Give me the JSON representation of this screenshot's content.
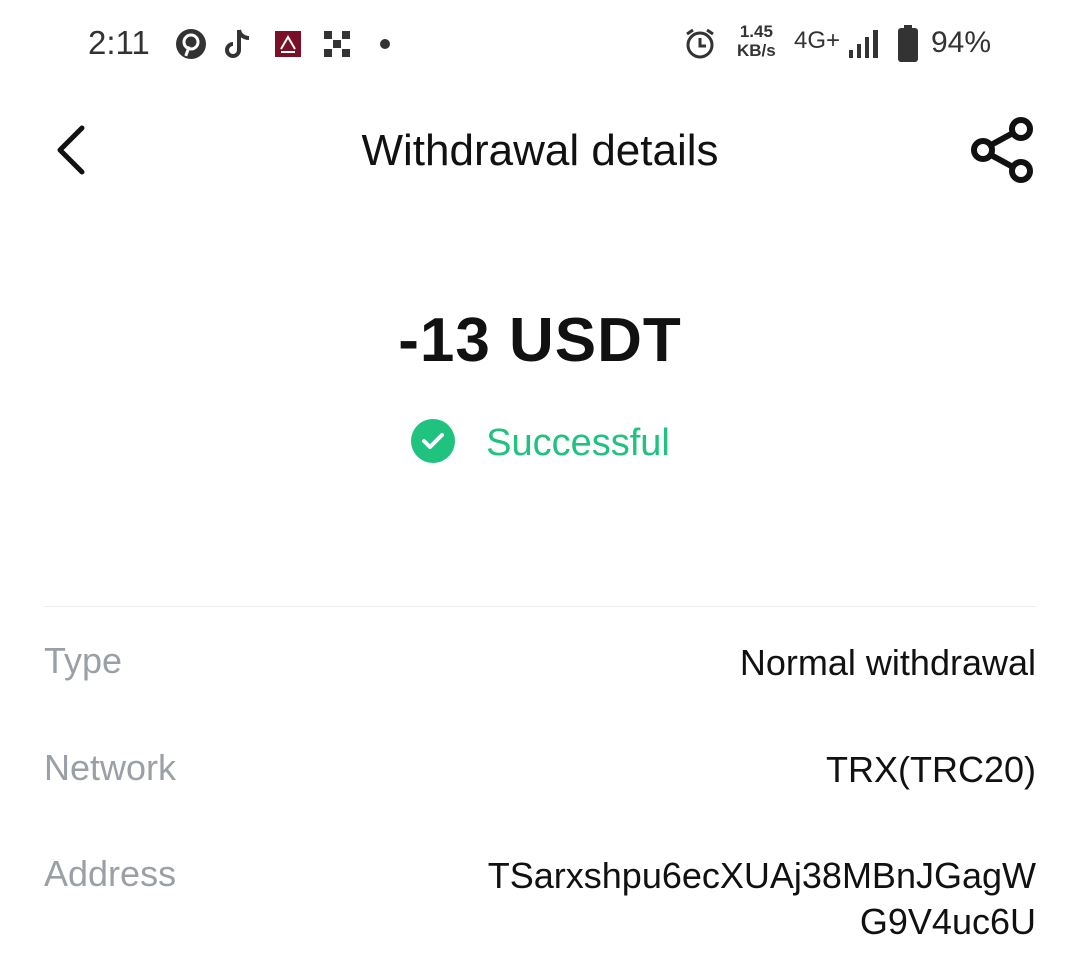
{
  "status_bar": {
    "time": "2:11",
    "speed_value": "1.45",
    "speed_unit": "KB/s",
    "network": "4G+",
    "battery_percent": "94%",
    "icons": [
      "pinterest-like-icon",
      "tiktok-icon",
      "app-badge-icon",
      "grid-app-icon",
      "notification-dot-icon",
      "alarm-icon",
      "signal-icon",
      "battery-icon"
    ]
  },
  "header": {
    "title": "Withdrawal details",
    "back_icon": "chevron-left-icon",
    "share_icon": "share-icon"
  },
  "summary": {
    "amount": "-13 USDT",
    "status": "Successful",
    "status_icon": "check-circle-icon",
    "status_color": "#20c27f"
  },
  "details": [
    {
      "label": "Type",
      "value": "Normal withdrawal"
    },
    {
      "label": "Network",
      "value": "TRX(TRC20)"
    },
    {
      "label": "Address",
      "value": "TSarxshpu6ecXUAj38MBnJGagW",
      "value_line2": "G9V4uc6U"
    }
  ]
}
